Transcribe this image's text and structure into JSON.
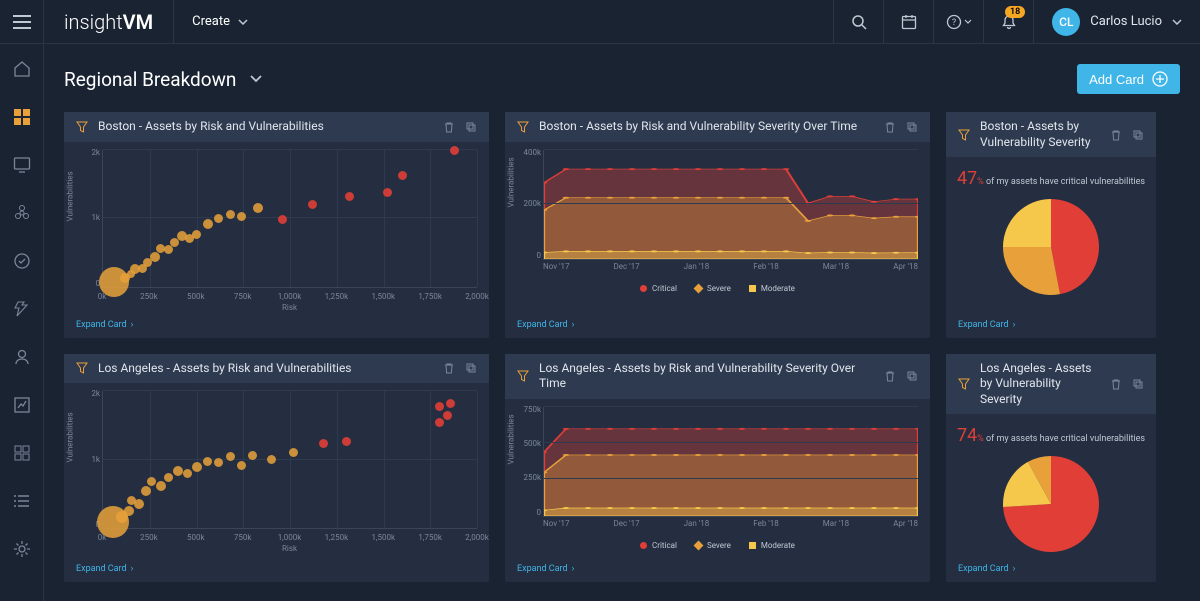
{
  "app": {
    "brand_light": "insight",
    "brand_bold": "VM",
    "create_label": "Create"
  },
  "topbar": {
    "notification_count": "18",
    "user_initials": "CL",
    "user_name": "Carlos Lucio"
  },
  "page": {
    "title": "Regional Breakdown",
    "add_card_label": "Add Card"
  },
  "cards": {
    "boston_scatter": {
      "title": "Boston - Assets by Risk and Vulnerabilities",
      "expand": "Expand Card",
      "xlabel": "Risk",
      "ylabel": "Vulnerabilities"
    },
    "boston_line": {
      "title": "Boston - Assets by Risk and Vulnerability Severity Over Time",
      "expand": "Expand Card",
      "ylabel": "Vulnerabilities"
    },
    "boston_pie": {
      "title": "Boston - Assets by Vulnerability Severity",
      "expand": "Expand Card",
      "pct": "47",
      "pct_suffix": "%",
      "caption": "of my assets have critical vulnerabilities"
    },
    "la_scatter": {
      "title": "Los Angeles - Assets by Risk and Vulnerabilities",
      "expand": "Expand Card",
      "xlabel": "Risk",
      "ylabel": "Vulnerabilities"
    },
    "la_line": {
      "title": "Los Angeles - Assets by Risk and Vulnerability Severity Over Time",
      "expand": "Expand Card",
      "ylabel": "Vulnerabilities"
    },
    "la_pie": {
      "title": "Los Angeles - Assets by Vulnerability Severity",
      "expand": "Expand Card",
      "pct": "74",
      "pct_suffix": "%",
      "caption": "of my assets have critical vulnerabilities"
    }
  },
  "legend": {
    "critical": "Critical",
    "severe": "Severe",
    "moderate": "Moderate"
  },
  "colors": {
    "critical": "#e03e36",
    "severe": "#e8a13a",
    "moderate": "#f5c84b",
    "accent": "#3fb5e8"
  },
  "chart_data": [
    {
      "id": "boston_scatter",
      "type": "scatter",
      "xlabel": "Risk",
      "ylabel": "Vulnerabilities",
      "x_ticks": [
        "0k",
        "250k",
        "500k",
        "750k",
        "1,000k",
        "1,250k",
        "1,500k",
        "1,750k",
        "2,000k"
      ],
      "y_ticks": [
        "0",
        "1k",
        "2k"
      ],
      "points": [
        {
          "x": 60,
          "y": 60,
          "size": 30,
          "c": "orange"
        },
        {
          "x": 120,
          "y": 120,
          "size": 10,
          "c": "orange"
        },
        {
          "x": 150,
          "y": 180,
          "size": 8,
          "c": "orange"
        },
        {
          "x": 170,
          "y": 260,
          "size": 10,
          "c": "orange"
        },
        {
          "x": 210,
          "y": 260,
          "size": 9,
          "c": "orange"
        },
        {
          "x": 240,
          "y": 350,
          "size": 9,
          "c": "orange"
        },
        {
          "x": 280,
          "y": 430,
          "size": 10,
          "c": "orange"
        },
        {
          "x": 310,
          "y": 560,
          "size": 9,
          "c": "orange"
        },
        {
          "x": 350,
          "y": 540,
          "size": 9,
          "c": "orange"
        },
        {
          "x": 380,
          "y": 650,
          "size": 9,
          "c": "orange"
        },
        {
          "x": 420,
          "y": 740,
          "size": 10,
          "c": "orange"
        },
        {
          "x": 460,
          "y": 700,
          "size": 9,
          "c": "orange"
        },
        {
          "x": 500,
          "y": 760,
          "size": 9,
          "c": "orange"
        },
        {
          "x": 560,
          "y": 920,
          "size": 10,
          "c": "orange"
        },
        {
          "x": 620,
          "y": 1000,
          "size": 9,
          "c": "orange"
        },
        {
          "x": 680,
          "y": 1050,
          "size": 9,
          "c": "orange"
        },
        {
          "x": 740,
          "y": 1020,
          "size": 9,
          "c": "orange"
        },
        {
          "x": 830,
          "y": 1150,
          "size": 10,
          "c": "orange"
        },
        {
          "x": 960,
          "y": 980,
          "size": 9,
          "c": "red"
        },
        {
          "x": 1120,
          "y": 1200,
          "size": 9,
          "c": "red"
        },
        {
          "x": 1320,
          "y": 1320,
          "size": 9,
          "c": "red"
        },
        {
          "x": 1520,
          "y": 1380,
          "size": 9,
          "c": "red"
        },
        {
          "x": 1600,
          "y": 1620,
          "size": 9,
          "c": "red"
        },
        {
          "x": 1880,
          "y": 1980,
          "size": 9,
          "c": "red"
        }
      ],
      "x_max": 2000,
      "y_max": 2000
    },
    {
      "id": "boston_line",
      "type": "area",
      "ylabel": "Vulnerabilities",
      "x_ticks": [
        "Nov '17",
        "Dec '17",
        "Jan '18",
        "Feb '18",
        "Mar '18",
        "Apr '18"
      ],
      "y_ticks": [
        "0",
        "200k",
        "400k"
      ],
      "series": [
        {
          "name": "Critical",
          "color": "#e03e36",
          "values": [
            280,
            330,
            330,
            330,
            330,
            330,
            330,
            330,
            330,
            330,
            330,
            330,
            205,
            230,
            230,
            210,
            220,
            220
          ]
        },
        {
          "name": "Severe",
          "color": "#e8a13a",
          "values": [
            180,
            225,
            225,
            225,
            225,
            225,
            225,
            225,
            225,
            225,
            225,
            225,
            140,
            160,
            160,
            150,
            155,
            155
          ]
        },
        {
          "name": "Moderate",
          "color": "#f5c84b",
          "values": [
            24,
            28,
            28,
            28,
            28,
            28,
            28,
            28,
            28,
            28,
            28,
            28,
            22,
            24,
            24,
            22,
            23,
            23
          ]
        }
      ],
      "y_max": 400
    },
    {
      "id": "boston_pie",
      "type": "pie",
      "slices": [
        {
          "name": "Critical",
          "value": 47,
          "color": "#e03e36"
        },
        {
          "name": "Severe",
          "value": 28,
          "color": "#e8a13a"
        },
        {
          "name": "Moderate",
          "value": 25,
          "color": "#f5c84b"
        }
      ]
    },
    {
      "id": "la_scatter",
      "type": "scatter",
      "xlabel": "Risk",
      "ylabel": "Vulnerabilities",
      "x_ticks": [
        "0k",
        "250k",
        "500k",
        "750k",
        "1,000k",
        "1,250k",
        "1,500k",
        "1,750k",
        "2,000k"
      ],
      "y_ticks": [
        "0",
        "1k",
        "2k"
      ],
      "points": [
        {
          "x": 55,
          "y": 90,
          "size": 32,
          "c": "orange"
        },
        {
          "x": 100,
          "y": 160,
          "size": 12,
          "c": "orange"
        },
        {
          "x": 140,
          "y": 250,
          "size": 10,
          "c": "orange"
        },
        {
          "x": 150,
          "y": 400,
          "size": 9,
          "c": "orange"
        },
        {
          "x": 190,
          "y": 350,
          "size": 10,
          "c": "orange"
        },
        {
          "x": 230,
          "y": 540,
          "size": 10,
          "c": "orange"
        },
        {
          "x": 260,
          "y": 680,
          "size": 9,
          "c": "orange"
        },
        {
          "x": 310,
          "y": 620,
          "size": 10,
          "c": "orange"
        },
        {
          "x": 350,
          "y": 740,
          "size": 9,
          "c": "orange"
        },
        {
          "x": 400,
          "y": 840,
          "size": 10,
          "c": "orange"
        },
        {
          "x": 450,
          "y": 800,
          "size": 9,
          "c": "orange"
        },
        {
          "x": 500,
          "y": 900,
          "size": 10,
          "c": "orange"
        },
        {
          "x": 560,
          "y": 980,
          "size": 9,
          "c": "orange"
        },
        {
          "x": 620,
          "y": 960,
          "size": 9,
          "c": "orange"
        },
        {
          "x": 680,
          "y": 1040,
          "size": 9,
          "c": "orange"
        },
        {
          "x": 740,
          "y": 920,
          "size": 9,
          "c": "orange"
        },
        {
          "x": 800,
          "y": 1060,
          "size": 9,
          "c": "orange"
        },
        {
          "x": 900,
          "y": 1000,
          "size": 9,
          "c": "orange"
        },
        {
          "x": 1020,
          "y": 1100,
          "size": 9,
          "c": "orange"
        },
        {
          "x": 1180,
          "y": 1240,
          "size": 9,
          "c": "red"
        },
        {
          "x": 1300,
          "y": 1260,
          "size": 9,
          "c": "red"
        },
        {
          "x": 1800,
          "y": 1540,
          "size": 9,
          "c": "red"
        },
        {
          "x": 1840,
          "y": 1640,
          "size": 9,
          "c": "red"
        },
        {
          "x": 1800,
          "y": 1780,
          "size": 9,
          "c": "red"
        },
        {
          "x": 1860,
          "y": 1820,
          "size": 9,
          "c": "red"
        }
      ],
      "x_max": 2000,
      "y_max": 2000
    },
    {
      "id": "la_line",
      "type": "area",
      "ylabel": "Vulnerabilities",
      "x_ticks": [
        "Nov '17",
        "Dec '17",
        "Jan '18",
        "Feb '18",
        "Mar '18",
        "Apr '18"
      ],
      "y_ticks": [
        "0",
        "250k",
        "500k",
        "750k"
      ],
      "series": [
        {
          "name": "Critical",
          "color": "#e03e36",
          "values": [
            440,
            600,
            600,
            600,
            600,
            600,
            600,
            600,
            600,
            600,
            600,
            600,
            600,
            600,
            600,
            600,
            600,
            600
          ]
        },
        {
          "name": "Severe",
          "color": "#e8a13a",
          "values": [
            300,
            420,
            420,
            420,
            420,
            420,
            420,
            420,
            420,
            420,
            420,
            420,
            420,
            420,
            420,
            420,
            420,
            420
          ]
        },
        {
          "name": "Moderate",
          "color": "#f5c84b",
          "values": [
            40,
            55,
            55,
            55,
            55,
            55,
            55,
            55,
            55,
            55,
            55,
            55,
            55,
            55,
            55,
            55,
            55,
            55
          ]
        }
      ],
      "y_max": 750
    },
    {
      "id": "la_pie",
      "type": "pie",
      "slices": [
        {
          "name": "Critical",
          "value": 74,
          "color": "#e03e36"
        },
        {
          "name": "Moderate",
          "value": 18,
          "color": "#f5c84b"
        },
        {
          "name": "Severe",
          "value": 8,
          "color": "#e8a13a"
        }
      ]
    }
  ]
}
